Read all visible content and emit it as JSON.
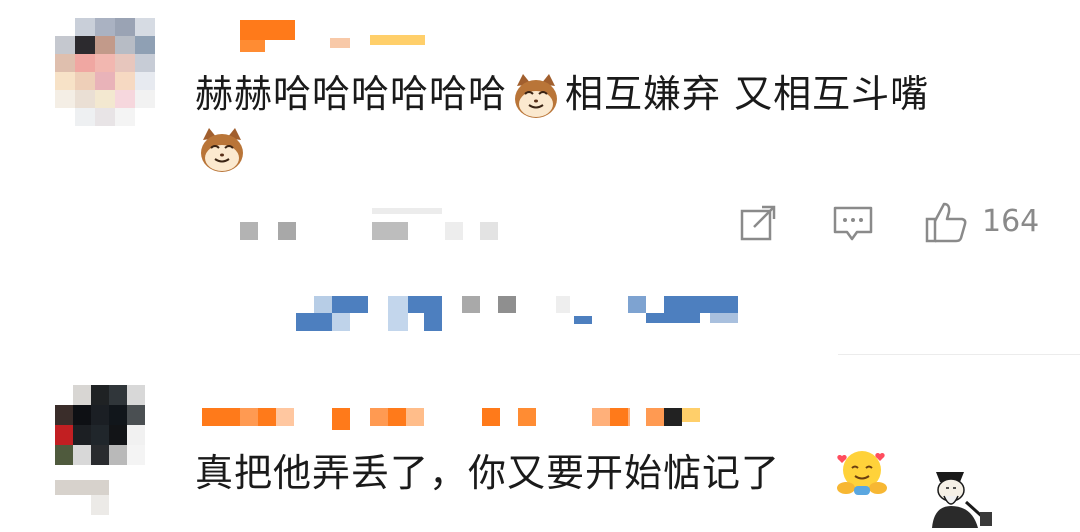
{
  "comments": [
    {
      "text_part1": "赫赫哈哈哈哈哈哈",
      "text_part2": "相互嫌弃 又相互斗嘴",
      "emoji": "cat-face-emoji",
      "likes": "164",
      "actions": [
        "share-icon",
        "reply-icon",
        "like-icon"
      ]
    },
    {
      "text": "真把他弄丢了，你又要开始惦记了",
      "emoji": "hugging-face-emoji",
      "sticker": "scholar-sticker"
    }
  ],
  "colors": {
    "username_orange": "#ff7a1a",
    "link_blue": "#4d7fbf",
    "meta_gray": "#9a9a9a",
    "text": "#1a1a1a"
  }
}
